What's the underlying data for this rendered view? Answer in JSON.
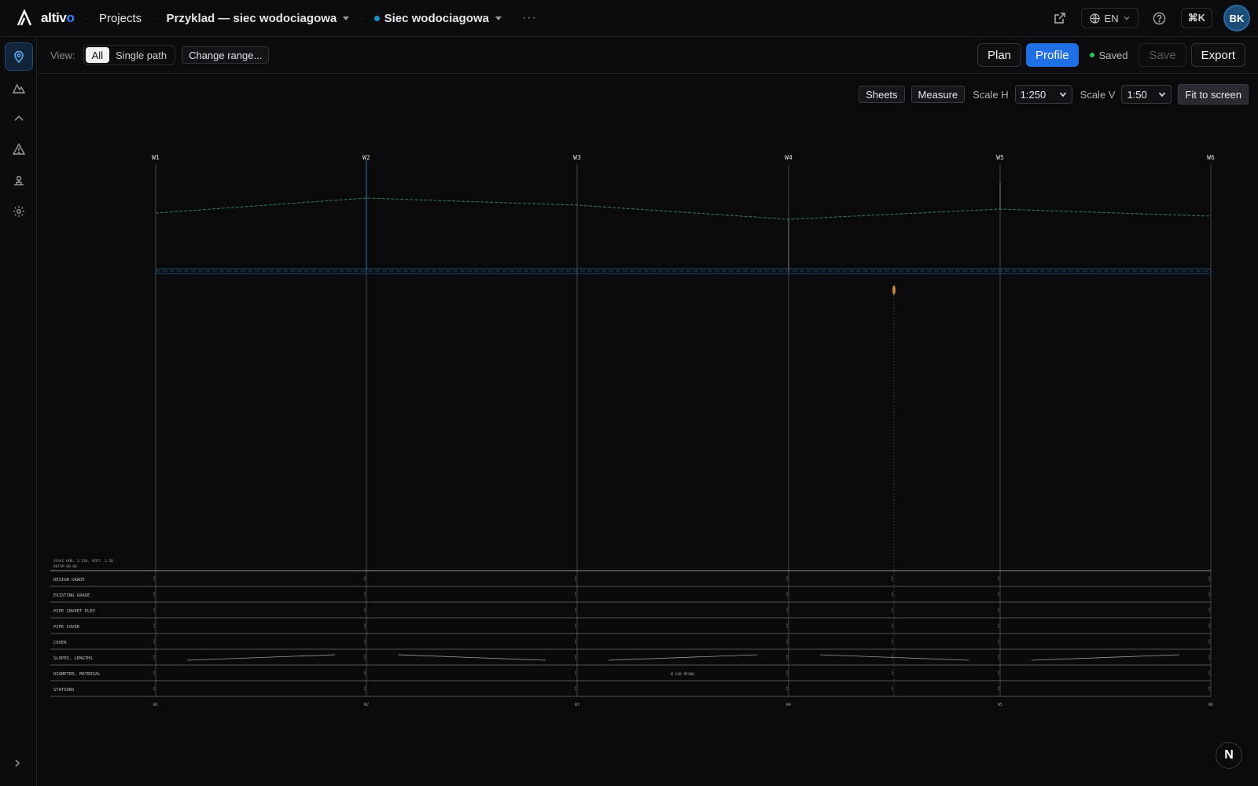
{
  "app": {
    "logo_prefix": "altiv",
    "logo_suffix": "o"
  },
  "topbar": {
    "projects": "Projects",
    "project_name": "Przyklad — siec wodociagowa",
    "network_name": "Siec wodociagowa",
    "more": "···",
    "lang": "EN",
    "shortcut": "⌘K",
    "avatar": "BK"
  },
  "toolbar": {
    "view_label": "View:",
    "view_all": "All",
    "view_single": "Single path",
    "change_range": "Change range...",
    "plan": "Plan",
    "profile": "Profile",
    "saved": "Saved",
    "save": "Save",
    "export": "Export"
  },
  "canvas_tools": {
    "sheets": "Sheets",
    "measure": "Measure",
    "scale_h_label": "Scale H",
    "scale_h_value": "1:250",
    "scale_v_label": "Scale V",
    "scale_v_value": "1:50",
    "fit": "Fit to screen"
  },
  "profile": {
    "nodes": [
      "W1",
      "W2",
      "W3",
      "W4",
      "W5",
      "W6"
    ],
    "scale_note": "SCALE HOR. 1:250, VERT. 1:50",
    "datum_note": "DATUM 88.00",
    "table_rows": [
      "DESIGN GRADE",
      "EXISTING GRADE",
      "PIPE INVERT ELEV",
      "PIPE COVER",
      "COVER",
      "SLOPES, LENGTHS",
      "DIAMETER, MATERIAL",
      "STATIONS"
    ],
    "diameter_material": "Ø 110 PE100"
  },
  "fab_label": "N"
}
